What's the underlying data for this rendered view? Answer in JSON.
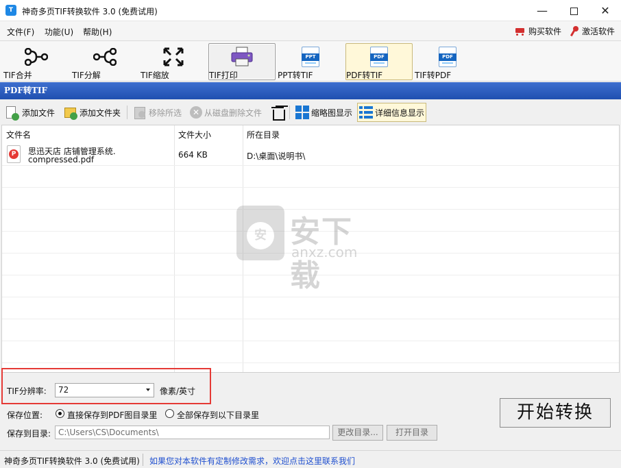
{
  "window": {
    "title": "神奇多页TIF转换软件 3.0 (免费试用)",
    "icon": "app-logo-icon",
    "minimize_glyph": "—",
    "close_glyph": "✕"
  },
  "menu": {
    "items": [
      "文件(F)",
      "功能(U)",
      "帮助(H)"
    ],
    "buy_label": "购买软件",
    "activate_label": "激活软件"
  },
  "big_toolbar": {
    "items": [
      {
        "label": "TIF合并",
        "icon": "merge-icon"
      },
      {
        "label": "TIF分解",
        "icon": "split-icon"
      },
      {
        "label": "TIF缩放",
        "icon": "resize-icon"
      },
      {
        "label": "TIF打印",
        "icon": "printer-icon"
      },
      {
        "label": "PPT转TIF",
        "icon": "ppt-doc-icon",
        "badge": "PPT"
      },
      {
        "label": "PDF转TIF",
        "icon": "pdf-doc-icon",
        "badge": "PDF",
        "active": true
      },
      {
        "label": "TIF转PDF",
        "icon": "pdf-doc-icon",
        "badge": "PDF"
      }
    ]
  },
  "section_title": "PDF转TIF",
  "small_toolbar": {
    "add_file": "添加文件",
    "add_folder": "添加文件夹",
    "remove_selected": "移除所选",
    "delete_from_disk": "从磁盘删除文件",
    "thumbnail_view": "缩略图显示",
    "detail_view": "详细信息显示"
  },
  "table": {
    "columns": [
      "文件名",
      "文件大小",
      "所在目录"
    ],
    "rows": [
      {
        "name_line1": "思迅天店 店铺管理系统.",
        "name_line2": "compressed.pdf",
        "size": "664 KB",
        "dir": "D:\\桌面\\说明书\\"
      }
    ]
  },
  "watermark": {
    "text": "安下载",
    "domain": "anxz.com"
  },
  "settings": {
    "dpi_label": "TIF分辨率:",
    "dpi_value": "72",
    "dpi_unit": "像素/英寸",
    "save_location_label": "保存位置:",
    "option_same_dir": "直接保存到PDF图目录里",
    "option_custom_dir": "全部保存到以下目录里",
    "save_to_label": "保存到目录:",
    "save_path": "C:\\Users\\CS\\Documents\\",
    "change_dir_button": "更改目录...",
    "open_dir_button": "打开目录",
    "start_button": "开始转换"
  },
  "status": {
    "left": "神奇多页TIF转换软件 3.0 (免费试用)",
    "link": "如果您对本软件有定制修改需求，欢迎点击这里联系我们"
  },
  "colors": {
    "section_header": "#2a5bbf",
    "highlight_box": "#e53935",
    "link": "#1f4fcf",
    "active_tab_bg": "#fff8d9"
  }
}
